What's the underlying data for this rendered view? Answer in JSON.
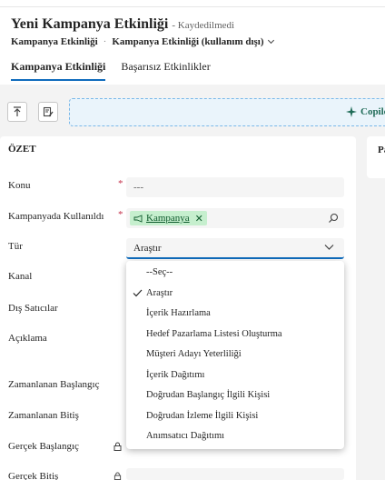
{
  "header": {
    "title": "Yeni Kampanya Etkinliği",
    "saved_status": "- Kaydedilmedi",
    "breadcrumb_entity": "Kampanya Etkinliği",
    "breadcrumb_form": "Kampanya Etkinliği (kullanım dışı)",
    "tabs": [
      {
        "label": "Kampanya Etkinliği",
        "active": true
      },
      {
        "label": "Başarısız Etkinlikler",
        "active": false
      }
    ]
  },
  "toolbar": {
    "copilot_label": "Copilo"
  },
  "side_card": {
    "label": "Pa"
  },
  "summary": {
    "section_title": "ÖZET",
    "fields": {
      "konu": {
        "label": "Konu",
        "value": "---"
      },
      "kampanya": {
        "label": "Kampanyada Kullanıldı",
        "tag": "Kampanya"
      },
      "tur": {
        "label": "Tür",
        "value": "Araştır"
      },
      "kanal": {
        "label": "Kanal"
      },
      "dis_saticilar": {
        "label": "Dış Satıcılar"
      },
      "aciklama": {
        "label": "Açıklama"
      },
      "zaman_baslangic": {
        "label": "Zamanlanan Başlangıç"
      },
      "zaman_bitis": {
        "label": "Zamanlanan Bitiş"
      },
      "gercek_baslangic": {
        "label": "Gerçek Başlangıç"
      },
      "gercek_bitis": {
        "label": "Gerçek Bitiş"
      }
    }
  },
  "dropdown": {
    "options": [
      {
        "label": "--Seç--",
        "selected": false
      },
      {
        "label": "Araştır",
        "selected": true
      },
      {
        "label": "İçerik Hazırlama",
        "selected": false
      },
      {
        "label": "Hedef Pazarlama Listesi Oluşturma",
        "selected": false
      },
      {
        "label": "Müşteri Adayı Yeterliliği",
        "selected": false
      },
      {
        "label": "İçerik Dağıtımı",
        "selected": false
      },
      {
        "label": "Doğrudan Başlangıç İlgili Kişisi",
        "selected": false
      },
      {
        "label": "Doğrudan İzleme İlgili Kişisi",
        "selected": false
      },
      {
        "label": "Anımsatıcı Dağıtımı",
        "selected": false
      }
    ]
  },
  "colors": {
    "accent": "#0f6cbd",
    "required": "#c4314b",
    "tag_bg": "#c6efce"
  }
}
